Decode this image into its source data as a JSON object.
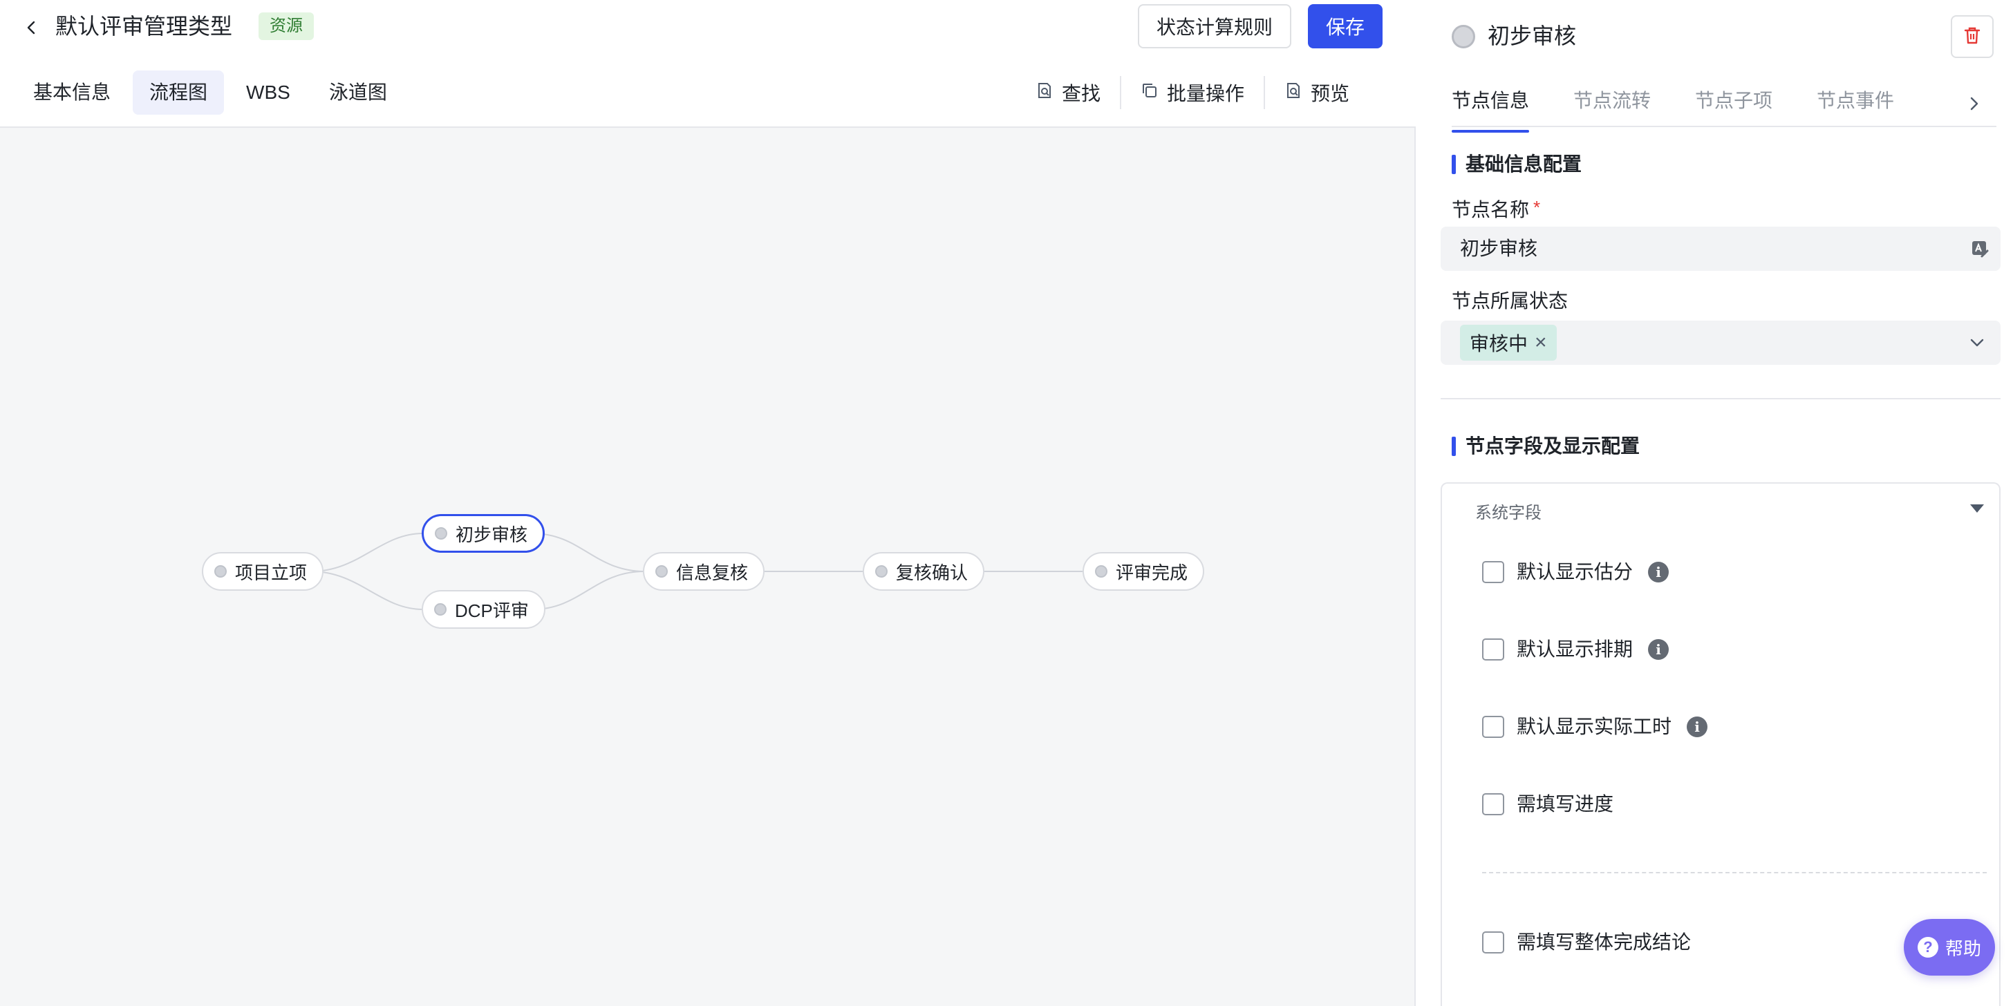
{
  "header": {
    "title": "默认评审管理类型",
    "tag": "资源",
    "status_rule_label": "状态计算规则",
    "save_label": "保存"
  },
  "view_tabs": [
    {
      "label": "基本信息",
      "active": false
    },
    {
      "label": "流程图",
      "active": true
    },
    {
      "label": "WBS",
      "active": false
    },
    {
      "label": "泳道图",
      "active": false
    }
  ],
  "toolbar": {
    "find_label": "查找",
    "batch_label": "批量操作",
    "preview_label": "预览"
  },
  "flow": {
    "nodes": [
      {
        "id": "n1",
        "label": "项目立项"
      },
      {
        "id": "n2",
        "label": "初步审核",
        "selected": true
      },
      {
        "id": "n3",
        "label": "DCP评审"
      },
      {
        "id": "n4",
        "label": "信息复核"
      },
      {
        "id": "n5",
        "label": "复核确认"
      },
      {
        "id": "n6",
        "label": "评审完成"
      }
    ]
  },
  "panel": {
    "title": "初步审核",
    "tabs": [
      {
        "label": "节点信息",
        "active": true
      },
      {
        "label": "节点流转",
        "active": false
      },
      {
        "label": "节点子项",
        "active": false
      },
      {
        "label": "节点事件",
        "active": false
      }
    ],
    "basic_section_title": "基础信息配置",
    "name_label": "节点名称",
    "required_mark": "*",
    "name_value": "初步审核",
    "status_label": "节点所属状态",
    "status_value": "审核中",
    "fields_section_title": "节点字段及显示配置",
    "system_fields_label": "系统字段",
    "checkboxes": [
      {
        "label": "默认显示估分",
        "checked": false,
        "info": true
      },
      {
        "label": "默认显示排期",
        "checked": false,
        "info": true
      },
      {
        "label": "默认显示实际工时",
        "checked": false,
        "info": true
      },
      {
        "label": "需填写进度",
        "checked": false,
        "info": false
      },
      {
        "label": "需填写整体完成结论",
        "checked": false,
        "info": false
      }
    ]
  },
  "help": {
    "label": "帮助"
  },
  "colors": {
    "primary": "#3250eb",
    "tag_bg": "#e3f5e1",
    "status_chip_bg": "#d3ede6",
    "help_bg": "#7b6cf2",
    "danger": "#e53935"
  }
}
